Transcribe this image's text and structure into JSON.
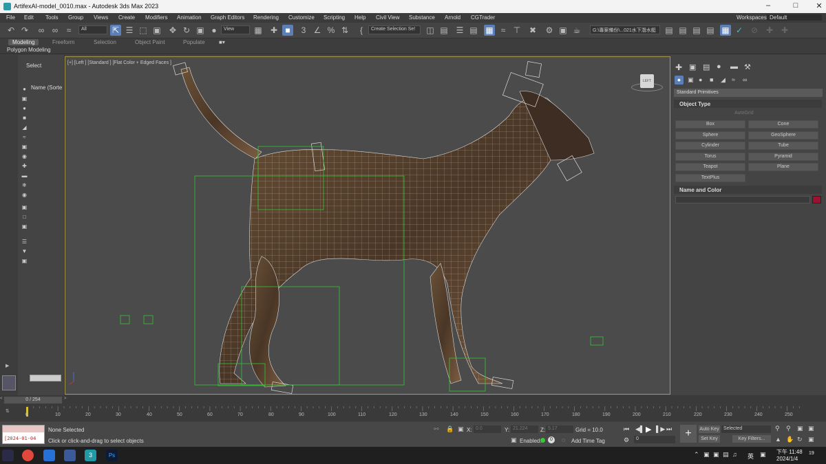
{
  "window": {
    "title": "ArtifexAI-model_0010.max - Autodesk 3ds Max 2023",
    "icon": "3dsmax-icon"
  },
  "menu": {
    "items": [
      "File",
      "Edit",
      "Tools",
      "Group",
      "Views",
      "Create",
      "Modifiers",
      "Animation",
      "Graph Editors",
      "Rendering",
      "Customize",
      "Scripting",
      "Help",
      "Civil View",
      "Substance",
      "Arnold",
      "CGTrader"
    ],
    "workspaces_label": "Workspaces:",
    "workspace_value": "Default"
  },
  "toolbar": {
    "filter_value": "All",
    "refcoord_value": "View",
    "selection_set_placeholder": "Create Selection Se!",
    "path_value": "G:\\專案備份\\...021水下潛水艇"
  },
  "ribbon": {
    "tabs": [
      "Modeling",
      "Freeform",
      "Selection",
      "Object Paint",
      "Populate"
    ],
    "active_tab": "Modeling",
    "sub_label": "Polygon Modeling"
  },
  "scene_explorer": {
    "header": "Select",
    "column": "Name (Sorte"
  },
  "viewport": {
    "label": "[+] [Left ] [Standard ] [Flat Color + Edged Faces ]",
    "cube_label": "LEFT"
  },
  "command_panel": {
    "category": "Standard Primitives",
    "object_type_header": "Object Type",
    "autogrid_label": "AutoGrid",
    "buttons": [
      "Box",
      "Cone",
      "Sphere",
      "GeoSphere",
      "Cylinder",
      "Tube",
      "Torus",
      "Pyramid",
      "Teapot",
      "Plane",
      "TextPlus"
    ],
    "name_color_header": "Name and Color",
    "color_swatch": "#9c1030"
  },
  "time": {
    "slider_value": "0 / 254",
    "ticks": [
      "0",
      "10",
      "20",
      "30",
      "40",
      "50",
      "60",
      "70",
      "80",
      "90",
      "100",
      "110",
      "120",
      "130",
      "140",
      "150",
      "160",
      "170",
      "180",
      "190",
      "200",
      "210",
      "220",
      "230",
      "240",
      "250"
    ]
  },
  "status": {
    "date": "[2024-01-04",
    "selection": "None Selected",
    "prompt": "Click or click-and-drag to select objects",
    "x_label": "X:",
    "x_value": "0.0",
    "y_label": "Y:",
    "y_value": "21.224",
    "z_label": "Z:",
    "z_value": "5.17",
    "grid": "Grid = 10.0",
    "enabled_label": "Enabled:",
    "add_time_tag": "Add Time Tag",
    "autokey": "Auto Key",
    "setkey": "Set Key",
    "selected_value": "Selected",
    "key_filters": "Key Filters...",
    "frame_value": "0"
  },
  "taskbar": {
    "time": "下午 11:48",
    "date": "2024/1/4",
    "ime": "英",
    "notif": "19"
  }
}
